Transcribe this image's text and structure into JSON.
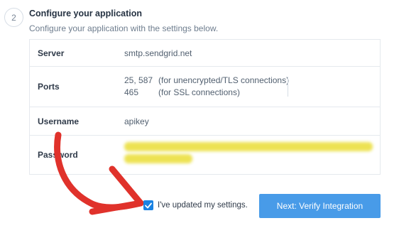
{
  "step": {
    "number": "2",
    "title": "Configure your application",
    "subtitle": "Configure your application with the settings below."
  },
  "settings": {
    "server": {
      "label": "Server",
      "value": "smtp.sendgrid.net"
    },
    "ports": {
      "label": "Ports",
      "lines": [
        {
          "ports": "25, 587",
          "note": "(for unencrypted/TLS connections)"
        },
        {
          "ports": "465",
          "note": "(for SSL connections)"
        }
      ]
    },
    "username": {
      "label": "Username",
      "value": "apikey"
    },
    "password": {
      "label": "Password",
      "redacted": true,
      "highlight_color": "#ece14a"
    }
  },
  "confirm": {
    "checkbox_label": "I've updated my settings.",
    "checked": true
  },
  "next_button": {
    "label": "Next: Verify Integration"
  },
  "colors": {
    "accent": "#1a82e2",
    "button": "#489be8",
    "annotation_arrow": "#e0322b"
  }
}
